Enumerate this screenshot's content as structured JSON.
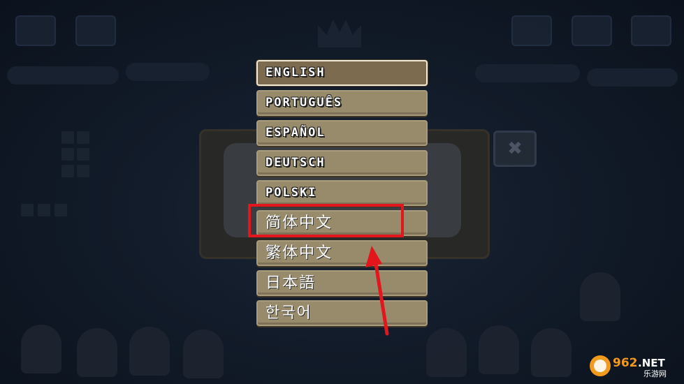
{
  "languages": [
    {
      "label": "ENGLISH",
      "script": "latin",
      "selected": true
    },
    {
      "label": "PORTUGUÊS",
      "script": "latin",
      "selected": false
    },
    {
      "label": "ESPAÑOL",
      "script": "latin",
      "selected": false
    },
    {
      "label": "DEUTSCH",
      "script": "latin",
      "selected": false
    },
    {
      "label": "POLSKI",
      "script": "latin",
      "selected": false
    },
    {
      "label": "简体中文",
      "script": "cjk",
      "selected": false
    },
    {
      "label": "繁体中文",
      "script": "cjk",
      "selected": false
    },
    {
      "label": "日本語",
      "script": "cjk",
      "selected": false
    },
    {
      "label": "한국어",
      "script": "cjk",
      "selected": false
    }
  ],
  "annotation": {
    "highlighted_item": "简体中文",
    "color": "#e3151d"
  },
  "background_close_glyph": "✖",
  "watermark": {
    "text": "962.NET",
    "subtext": "乐游网"
  },
  "colors": {
    "button_fill": "#978b6b",
    "selected_fill": "#7c6b4e",
    "selected_border": "#f1ead7",
    "background": "#121b29"
  }
}
